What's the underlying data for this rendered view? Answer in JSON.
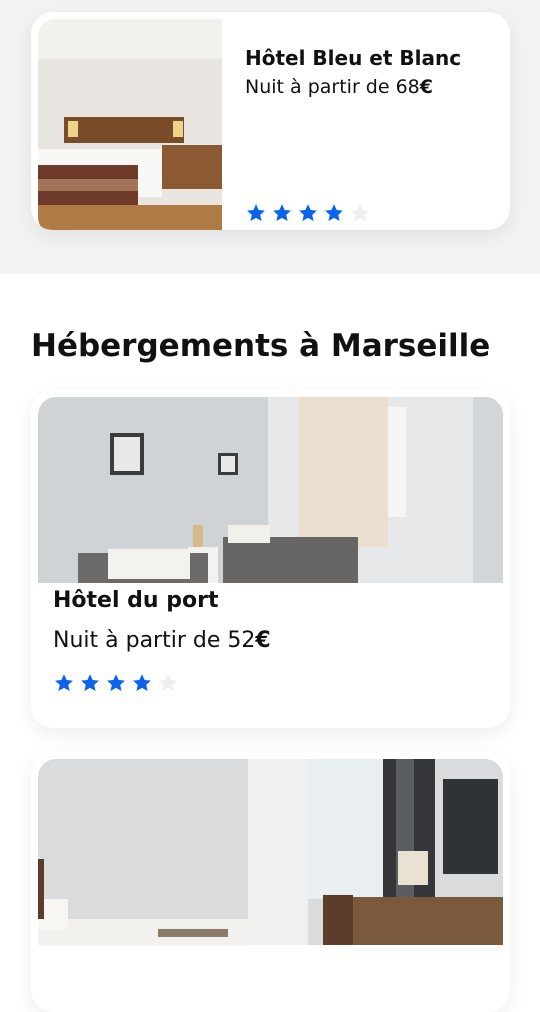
{
  "featured_hotel": {
    "name": "Hôtel Bleu et Blanc",
    "price_prefix": "Nuit à partir de 68",
    "currency": "€",
    "rating": 4,
    "max_rating": 5
  },
  "section": {
    "title": "Hébergements à Marseille"
  },
  "hotels": [
    {
      "name": "Hôtel du port",
      "price_prefix": "Nuit à partir de 52",
      "currency": "€",
      "rating": 4,
      "max_rating": 5
    },
    {
      "name": "",
      "price_prefix": "",
      "currency": "",
      "rating": 0,
      "max_rating": 5
    }
  ],
  "colors": {
    "star_filled": "#0a63ea",
    "star_empty": "#eeeeee",
    "band_bg": "#f2f2f2"
  }
}
